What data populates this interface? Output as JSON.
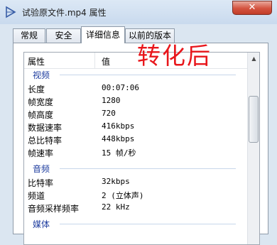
{
  "window": {
    "title": "试验原文件.mp4 属性",
    "close": "✕"
  },
  "tabs": [
    {
      "label": "常规"
    },
    {
      "label": "安全"
    },
    {
      "label": "详细信息",
      "active": true
    },
    {
      "label": "以前的版本"
    }
  ],
  "list": {
    "header": {
      "property": "属性",
      "value": "值"
    },
    "groups": {
      "video": {
        "label": "视频",
        "rows": [
          {
            "key": "长度",
            "value": "00:07:06"
          },
          {
            "key": "帧宽度",
            "value": "1280"
          },
          {
            "key": "帧高度",
            "value": "720"
          },
          {
            "key": "数据速率",
            "value": "416kbps"
          },
          {
            "key": "总比特率",
            "value": "448kbps"
          },
          {
            "key": "帧速率",
            "value": "15 帧/秒"
          }
        ]
      },
      "audio": {
        "label": "音频",
        "rows": [
          {
            "key": "比特率",
            "value": "32kbps"
          },
          {
            "key": "频道",
            "value": "2 (立体声)"
          },
          {
            "key": "音频采样频率",
            "value": "22 kHz"
          }
        ]
      },
      "media": {
        "label": "媒体"
      }
    }
  },
  "overlay_text": "转化后"
}
